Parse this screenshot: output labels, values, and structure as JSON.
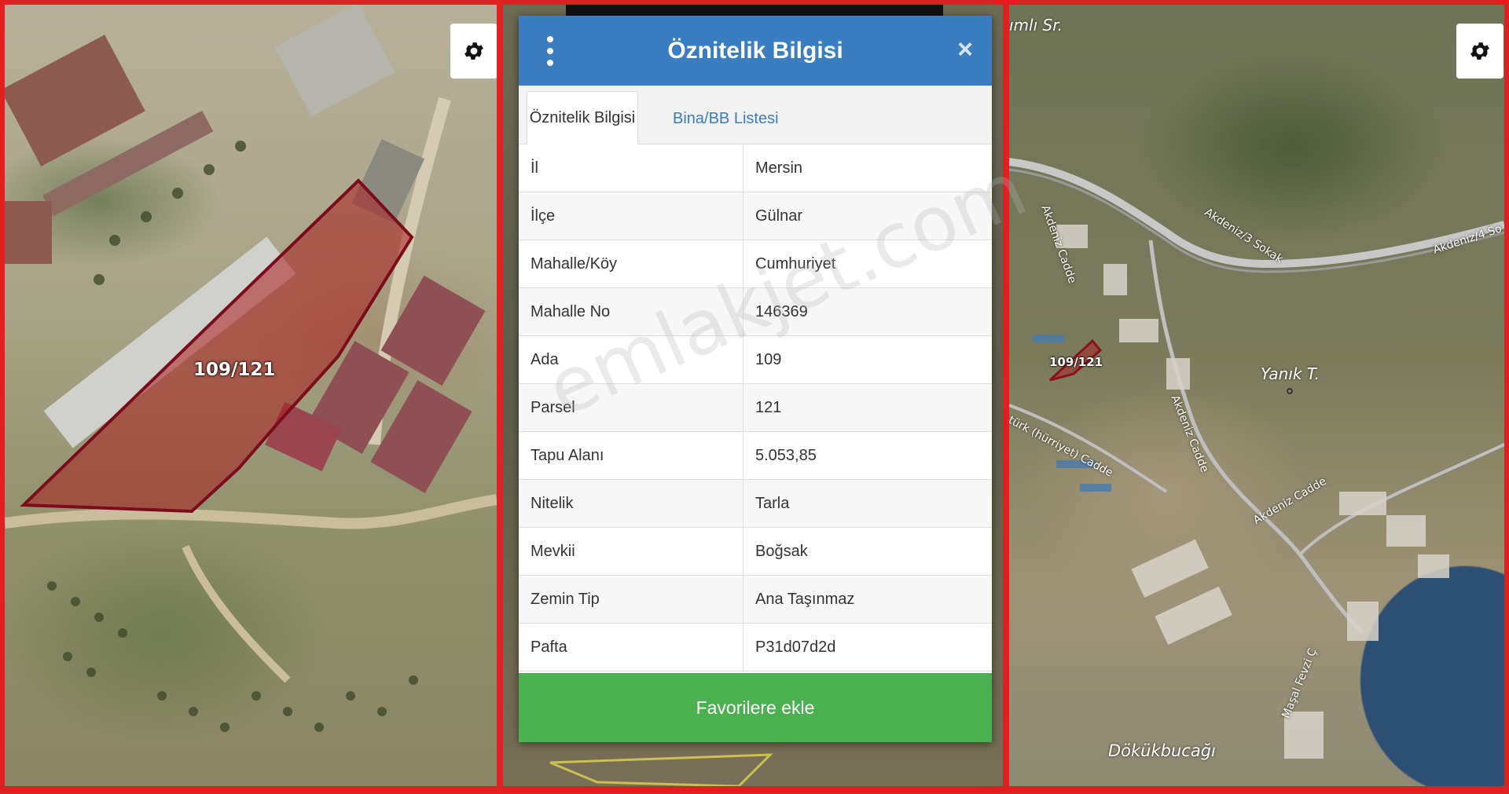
{
  "map_left": {
    "parcel_label": "109/121"
  },
  "map_right": {
    "parcel_label": "109/121",
    "places": [
      "ımlı Sr.",
      "Yanık T.",
      "Dökükbucağı"
    ],
    "streets": [
      "Akdeniz Cadde",
      "Akdeniz/3 Sokak",
      "Akdeniz/4 So",
      "Akdeniz Cadde",
      "türk (hürriyet) Cadde",
      "Akdeniz Cadde",
      "Maşal Fevzi Ç"
    ]
  },
  "dialog": {
    "title": "Öznitelik Bilgisi",
    "close_symbol": "×",
    "tabs": [
      "Öznitelik Bilgisi",
      "Bina/BB Listesi"
    ],
    "rows": [
      {
        "key": "İl",
        "value": "Mersin"
      },
      {
        "key": "İlçe",
        "value": "Gülnar"
      },
      {
        "key": "Mahalle/Köy",
        "value": "Cumhuriyet"
      },
      {
        "key": "Mahalle No",
        "value": "146369"
      },
      {
        "key": "Ada",
        "value": "109"
      },
      {
        "key": "Parsel",
        "value": "121"
      },
      {
        "key": "Tapu Alanı",
        "value": "5.053,85"
      },
      {
        "key": "Nitelik",
        "value": "Tarla"
      },
      {
        "key": "Mevkii",
        "value": "Boğsak"
      },
      {
        "key": "Zemin Tip",
        "value": "Ana Taşınmaz"
      },
      {
        "key": "Pafta",
        "value": "P31d07d2d"
      }
    ],
    "favorite_button": "Favorilere ekle"
  },
  "watermark": "emlakjet.com",
  "icons": {
    "settings": "gear-icon",
    "menu": "kebab-menu-icon",
    "close": "close-icon"
  },
  "colors": {
    "frame": "#e02020",
    "header": "#3a7dc0",
    "button": "#4bb050",
    "parcel": "#8b1020"
  }
}
